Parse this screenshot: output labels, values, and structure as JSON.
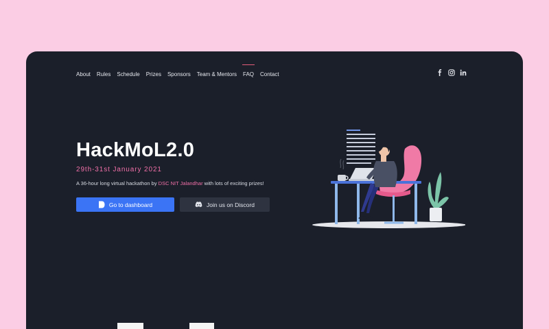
{
  "nav": {
    "items": [
      {
        "label": "About"
      },
      {
        "label": "Rules"
      },
      {
        "label": "Schedule"
      },
      {
        "label": "Prizes"
      },
      {
        "label": "Sponsors"
      },
      {
        "label": "Team & Mentors"
      },
      {
        "label": "FAQ",
        "active": true
      },
      {
        "label": "Contact"
      }
    ]
  },
  "social": [
    "facebook-icon",
    "instagram-icon",
    "linkedin-icon"
  ],
  "hero": {
    "title": "HackMoL2.0",
    "date": "29th-31st January 2021",
    "tagline_prefix": "A 36-hour long virtual hackathon by ",
    "tagline_org": "DSC NIT Jalandhar",
    "tagline_suffix": " with lots of exciting prizes!",
    "primary_button": "Go to dashboard",
    "secondary_button": "Join us on Discord"
  },
  "colors": {
    "page_background": "#fbcde4",
    "window_background": "#1b1f2a",
    "accent_pink": "#f170a8",
    "primary_blue": "#3b74f5",
    "secondary_button": "#2e3340"
  }
}
